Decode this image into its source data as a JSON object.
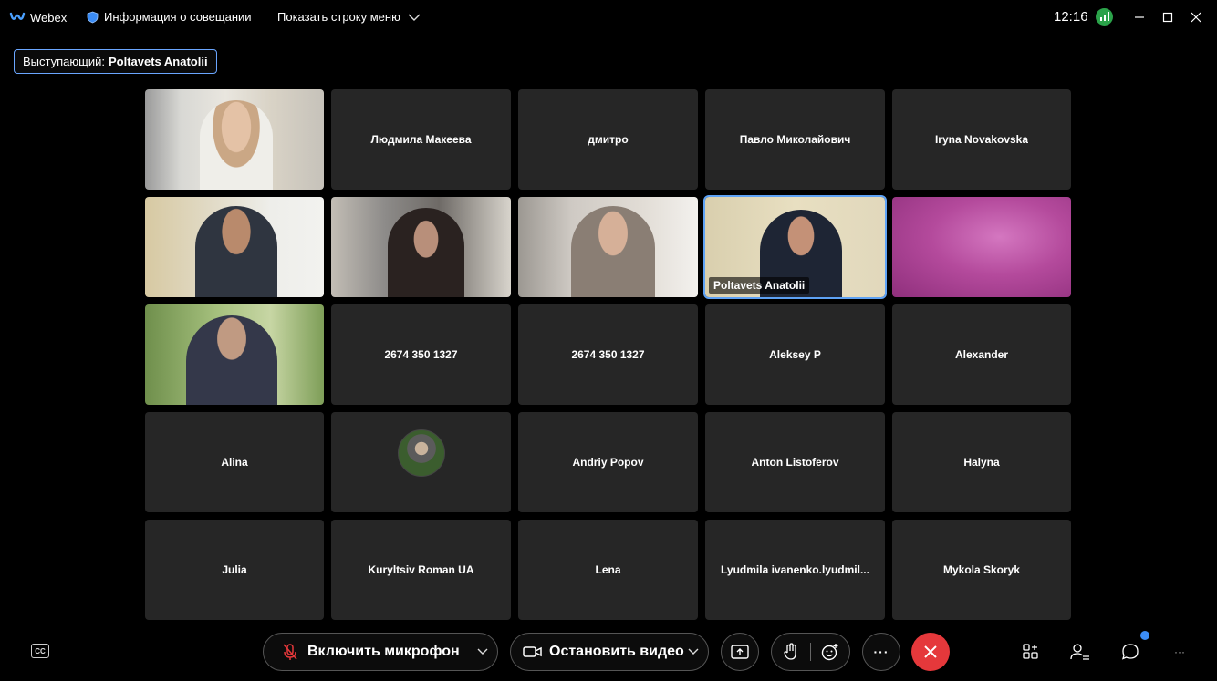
{
  "titlebar": {
    "app_name": "Webex",
    "meeting_info": "Информация о совещании",
    "show_menu": "Показать строку меню",
    "time": "12:16"
  },
  "speaker": {
    "label": "Выступающий:",
    "name": "Poltavets Anatolii"
  },
  "participants": [
    {
      "name": "",
      "type": "video"
    },
    {
      "name": "Людмила Макеева",
      "type": "name"
    },
    {
      "name": "дмитро",
      "type": "name"
    },
    {
      "name": "Павло Миколайович",
      "type": "name"
    },
    {
      "name": "Iryna Novakovska",
      "type": "name"
    },
    {
      "name": "",
      "type": "video"
    },
    {
      "name": "",
      "type": "video"
    },
    {
      "name": "",
      "type": "video"
    },
    {
      "name": "Poltavets Anatolii",
      "type": "video",
      "active": true
    },
    {
      "name": "",
      "type": "video"
    },
    {
      "name": "",
      "type": "video"
    },
    {
      "name": "2674 350 1327",
      "type": "name"
    },
    {
      "name": "2674 350 1327",
      "type": "name"
    },
    {
      "name": "Aleksey P",
      "type": "name"
    },
    {
      "name": "Alexander",
      "type": "name"
    },
    {
      "name": "Alina",
      "type": "name"
    },
    {
      "name": "",
      "type": "avatar"
    },
    {
      "name": "Andriy Popov",
      "type": "name"
    },
    {
      "name": "Anton Listoferov",
      "type": "name"
    },
    {
      "name": "Halyna",
      "type": "name"
    },
    {
      "name": "Julia",
      "type": "name"
    },
    {
      "name": "Kuryltsiv Roman UA",
      "type": "name"
    },
    {
      "name": "Lena",
      "type": "name"
    },
    {
      "name": "Lyudmila ivanenko.lyudmil...",
      "type": "name"
    },
    {
      "name": "Mykola Skoryk",
      "type": "name"
    }
  ],
  "controls": {
    "cc": "CC",
    "mic_label": "Включить микрофон",
    "video_label": "Остановить видео",
    "more": "···"
  },
  "colors": {
    "accent": "#5ea2f5",
    "end_call": "#e5383b",
    "signal": "#2ba34a",
    "tile_bg": "#262626"
  },
  "icons": [
    "webex-logo-icon",
    "shield-icon",
    "chevron-down-icon",
    "signal-icon",
    "minimize-icon",
    "maximize-icon",
    "close-icon",
    "cc-icon",
    "mic-muted-icon",
    "video-icon",
    "share-icon",
    "raise-hand-icon",
    "reactions-icon",
    "more-icon",
    "end-call-icon",
    "layout-icon",
    "participants-icon",
    "chat-icon"
  ]
}
